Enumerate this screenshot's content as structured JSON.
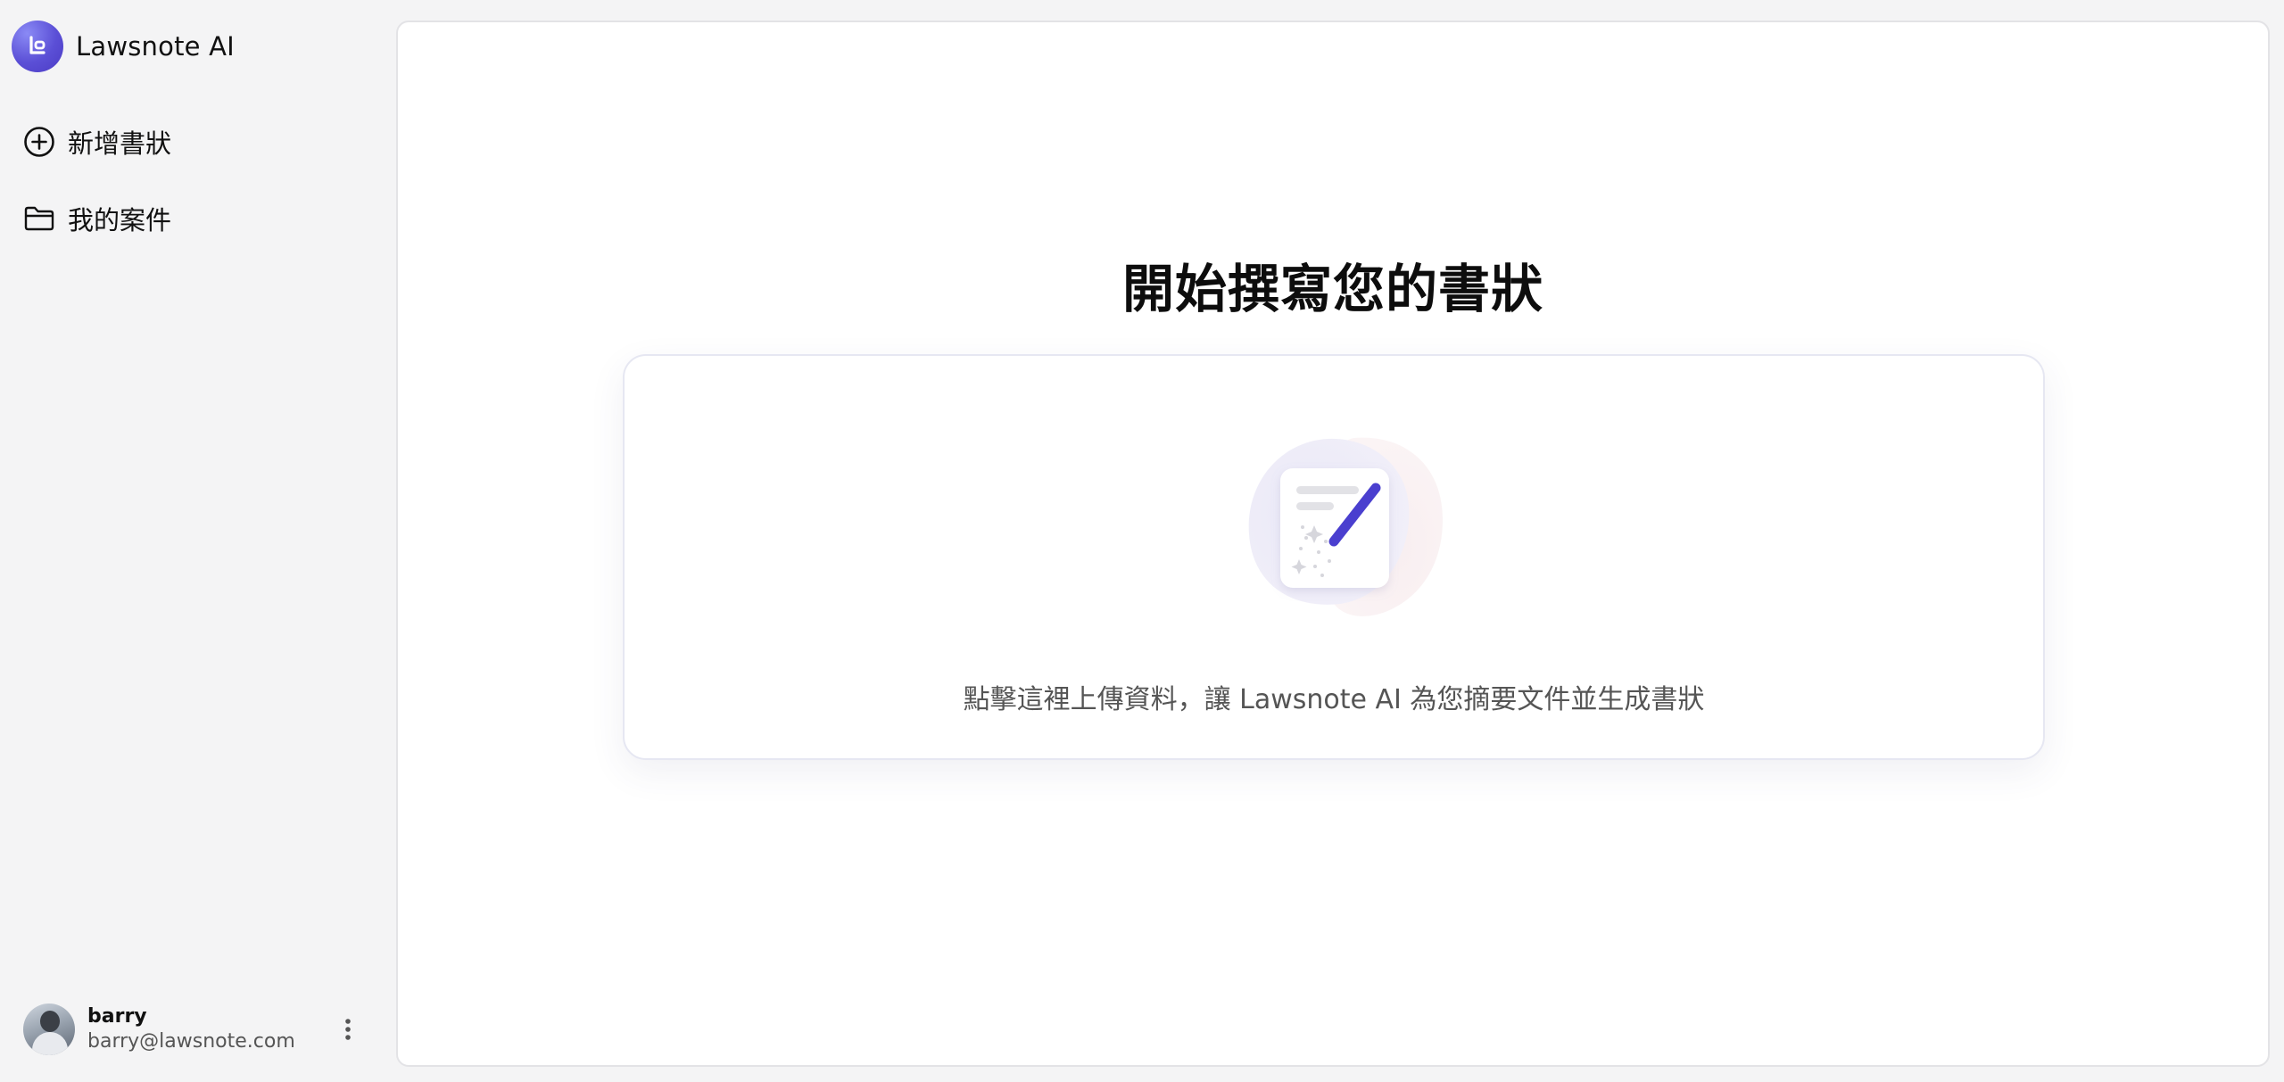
{
  "app": {
    "name": "Lawsnote AI",
    "accent": "#5b4fd6"
  },
  "sidebar": {
    "items": [
      {
        "label": "新增書狀",
        "icon": "plus-circle-icon"
      },
      {
        "label": "我的案件",
        "icon": "folder-icon"
      }
    ],
    "user": {
      "name": "barry",
      "email": "barry@lawsnote.com"
    }
  },
  "main": {
    "title": "開始撰寫您的書狀",
    "upload_prompt": "點擊這裡上傳資料，讓 Lawsnote AI 為您摘要文件並生成書狀"
  }
}
